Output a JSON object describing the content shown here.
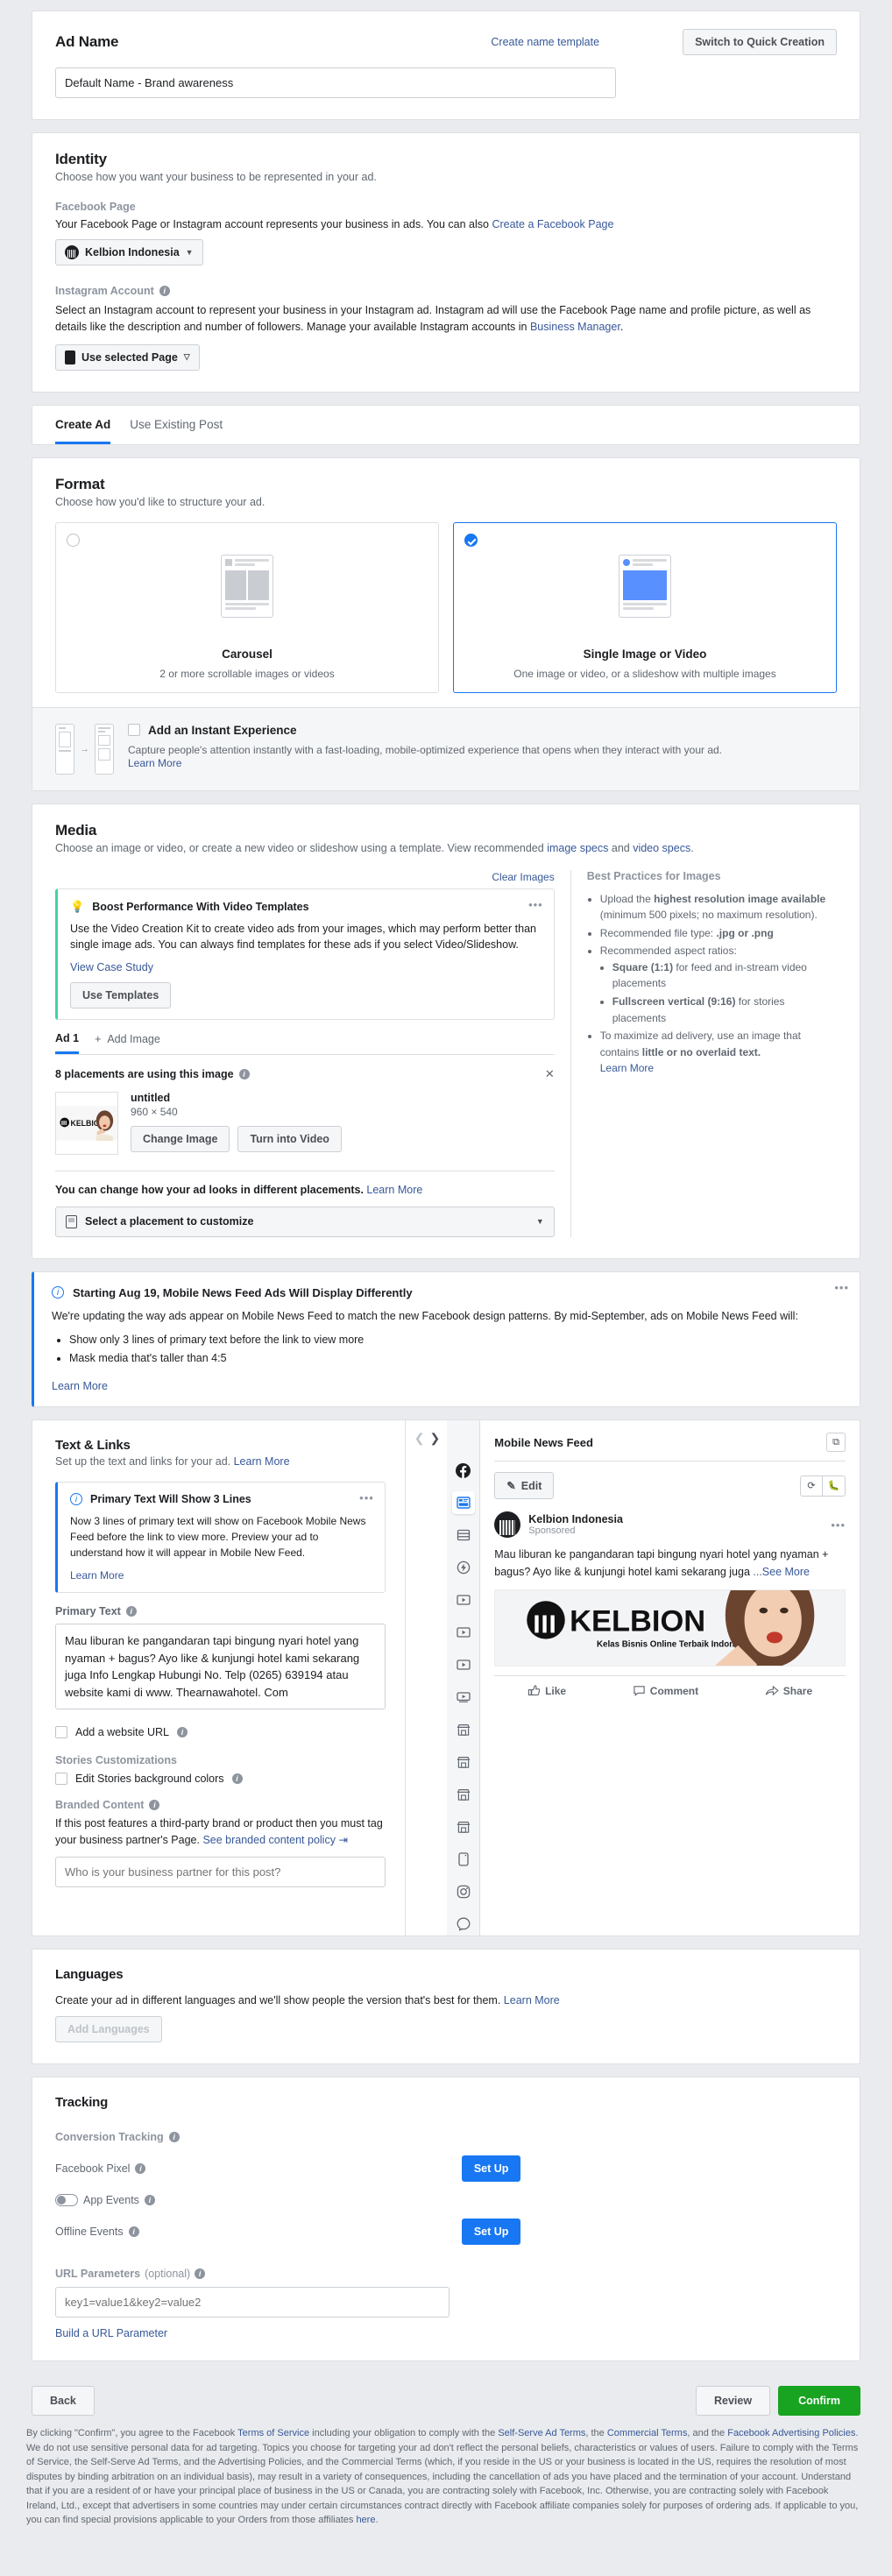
{
  "ad_name": {
    "title": "Ad Name",
    "create_template_link": "Create name template",
    "switch_button": "Switch to Quick Creation",
    "value": "Default Name - Brand awareness"
  },
  "identity": {
    "title": "Identity",
    "subtitle": "Choose how you want your business to be represented in your ad.",
    "facebook_page_label": "Facebook Page",
    "facebook_page_desc": "Your Facebook Page or Instagram account represents your business in ads. You can also ",
    "facebook_page_link": "Create a Facebook Page",
    "page_selected": "Kelbion Indonesia",
    "instagram_label": "Instagram Account",
    "instagram_desc": "Select an Instagram account to represent your business in your Instagram ad. Instagram ad will use the Facebook Page name and profile picture, as well as details like the description and number of followers. Manage your available Instagram accounts in ",
    "instagram_link": "Business Manager",
    "instagram_selected": "Use selected Page"
  },
  "tabs": [
    {
      "label": "Create Ad",
      "active": true
    },
    {
      "label": "Use Existing Post",
      "active": false
    }
  ],
  "format": {
    "title": "Format",
    "subtitle": "Choose how you'd like to structure your ad.",
    "options": [
      {
        "name": "Carousel",
        "desc": "2 or more scrollable images or videos",
        "selected": false
      },
      {
        "name": "Single Image or Video",
        "desc": "One image or video, or a slideshow with multiple images",
        "selected": true
      }
    ],
    "instant_experience": {
      "label": "Add an Instant Experience",
      "desc": "Capture people's attention instantly with a fast-loading, mobile-optimized experience that opens when they interact with your ad.",
      "learn_more": "Learn More"
    }
  },
  "media": {
    "title": "Media",
    "subtitle_a": "Choose an image or video, or create a new video or slideshow using a template. View recommended ",
    "link_image_specs": "image specs",
    "subtitle_and": " and ",
    "link_video_specs": "video specs",
    "clear_images": "Clear Images",
    "tip": {
      "title": "Boost Performance With Video Templates",
      "body": "Use the Video Creation Kit to create video ads from your images, which may perform better than single image ads. You can always find templates for these ads if you select Video/Slideshow.",
      "case_study": "View Case Study",
      "button": "Use Templates"
    },
    "ad_tab": "Ad 1",
    "add_image": "Add Image",
    "placements_note": "8 placements are using this image",
    "image_name": "untitled",
    "image_dims": "960 × 540",
    "change_image": "Change Image",
    "turn_into_video": "Turn into Video",
    "placement_note_a": "You can change how your ad looks in different placements. ",
    "placement_note_link": "Learn More",
    "placement_select": "Select a placement to customize",
    "best_practices": {
      "title": "Best Practices for Images",
      "items": [
        "Upload the highest resolution image available (minimum 500 pixels; no maximum resolution).",
        "Recommended file type: .jpg or .png",
        "Recommended aspect ratios:",
        "To maximize ad delivery, use an image that contains little or no overlaid text."
      ],
      "sub_items": [
        "Square (1:1) for feed and in-stream video placements",
        "Fullscreen vertical (9:16) for stories placements"
      ],
      "learn_more": "Learn More"
    }
  },
  "banner": {
    "title": "Starting Aug 19, Mobile News Feed Ads Will Display Differently",
    "body": "We're updating the way ads appear on Mobile News Feed to match the new Facebook design patterns. By mid-September, ads on Mobile News Feed will:",
    "bullets": [
      "Show only 3 lines of primary text before the link to view more",
      "Mask media that's taller than 4:5"
    ],
    "learn_more": "Learn More"
  },
  "text_links": {
    "title": "Text & Links",
    "subtitle": "Set up the text and links for your ad. ",
    "subtitle_link": "Learn More",
    "notice": {
      "title": "Primary Text Will Show 3 Lines",
      "body": "Now 3 lines of primary text will show on Facebook Mobile News Feed before the link to view more. Preview your ad to understand how it will appear in Mobile New Feed.",
      "learn_more": "Learn More"
    },
    "primary_text_label": "Primary Text",
    "primary_text_value": "Mau liburan ke pangandaran tapi bingung nyari hotel yang nyaman + bagus? Ayo like & kunjungi hotel kami sekarang juga Info Lengkap Hubungi No. Telp (0265) 639194 atau website kami di www. Thearnawahotel. Com",
    "add_website_url": "Add a website URL",
    "stories_label": "Stories Customizations",
    "edit_stories_colors": "Edit Stories background colors",
    "branded_label": "Branded Content",
    "branded_desc": "If this post features a third-party brand or product then you must tag your business partner's Page. ",
    "branded_link": "See branded content policy",
    "branded_placeholder": "Who is your business partner for this post?"
  },
  "preview": {
    "title": "Mobile News Feed",
    "edit_button": "Edit",
    "post": {
      "page_name": "Kelbion Indonesia",
      "sponsored": "Sponsored",
      "text": "Mau liburan ke pangandaran tapi bingung nyari hotel yang nyaman + bagus? Ayo like & kunjungi hotel kami sekarang juga",
      "see_more": "...See More",
      "image_brand": "KELBION",
      "image_tagline": "Kelas Bisnis Online Terbaik Indonesia"
    },
    "actions": [
      "Like",
      "Comment",
      "Share"
    ],
    "rail_icons": [
      "facebook-icon",
      "news-feed-icon",
      "article-icon",
      "instant-article-icon",
      "video-icon",
      "video-icon",
      "video-icon",
      "video-icon",
      "marketplace-icon",
      "marketplace-icon",
      "marketplace-icon",
      "marketplace-icon",
      "stories-icon",
      "instagram-icon",
      "messenger-icon"
    ]
  },
  "languages": {
    "title": "Languages",
    "desc": "Create your ad in different languages and we'll show people the version that's best for them. ",
    "link": "Learn More",
    "button": "Add Languages"
  },
  "tracking": {
    "title": "Tracking",
    "conversion_label": "Conversion Tracking",
    "facebook_pixel": "Facebook Pixel",
    "facebook_pixel_button": "Set Up",
    "app_events": "App Events",
    "offline_events": "Offline Events",
    "offline_events_button": "Set Up",
    "url_params_label": "URL Parameters",
    "url_params_optional": "(optional)",
    "url_params_placeholder": "key1=value1&key2=value2",
    "build_url": "Build a URL Parameter"
  },
  "footer": {
    "back": "Back",
    "review": "Review",
    "confirm": "Confirm",
    "legal_parts": [
      "By clicking \"Confirm\", you agree to the Facebook ",
      "Terms of Service",
      " including your obligation to comply with the ",
      "Self-Serve Ad Terms",
      ", the ",
      "Commercial Terms",
      ", and the ",
      "Facebook Advertising Policies",
      ". We do not use sensitive personal data for ad targeting. Topics you choose for targeting your ad don't reflect the personal beliefs, characteristics or values of users. Failure to comply with the Terms of Service, the Self-Serve Ad Terms, and the Advertising Policies, and the Commercial Terms (which, if you reside in the US or your business is located in the US, requires the resolution of most disputes by binding arbitration on an individual basis), may result in a variety of consequences, including the cancellation of ads you have placed and the termination of your account. Understand that if you are a resident of or have your principal place of business in the US or Canada, you are contracting solely with Facebook, Inc. Otherwise, you are contracting solely with Facebook Ireland, Ltd., except that advertisers in some countries may under certain circumstances contract directly with Facebook affiliate companies solely for purposes of ordering ads. If applicable to you, you can find special provisions applicable to your Orders from those affiliates ",
      "here",
      "."
    ]
  },
  "colors": {
    "accent": "#1877f2",
    "confirm_green": "#18a321",
    "tip_green": "#42d2a8",
    "link": "#385898"
  }
}
